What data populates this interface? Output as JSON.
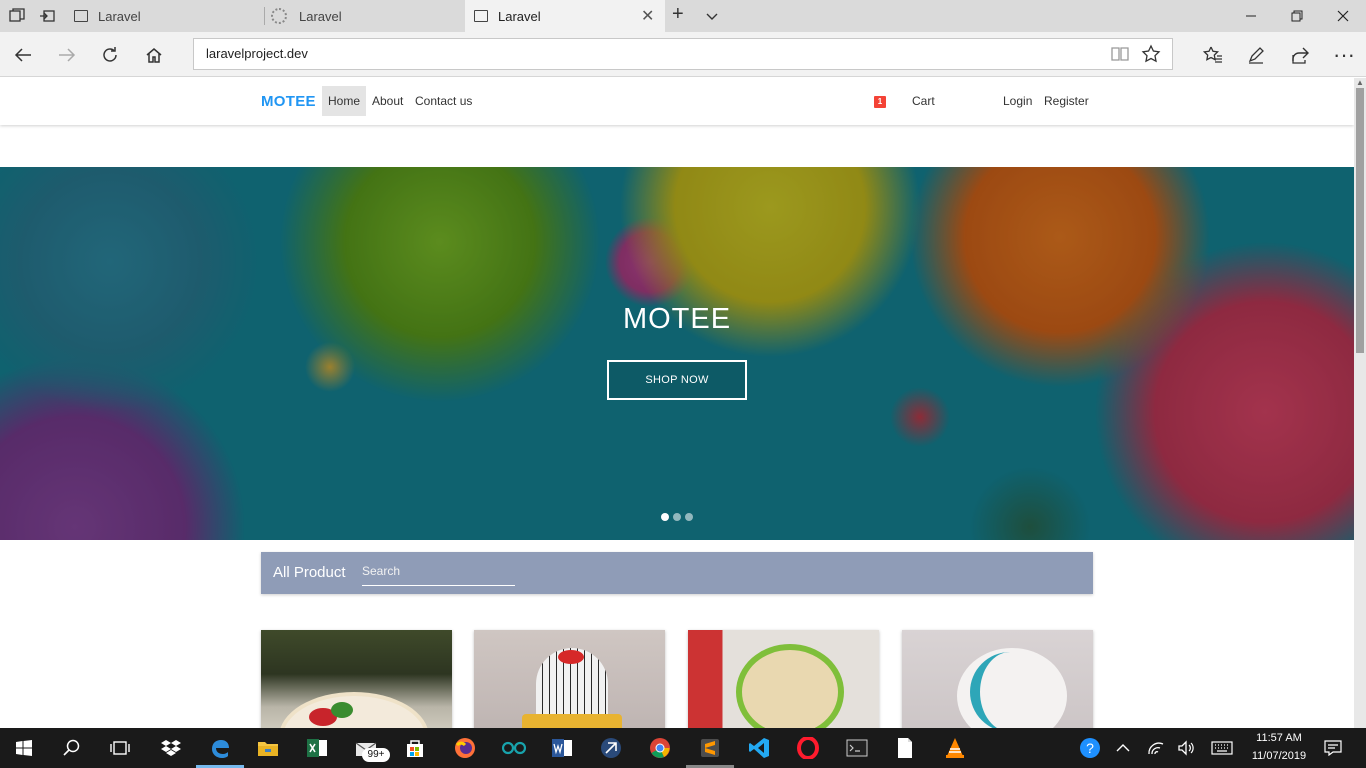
{
  "browser": {
    "tabs": [
      {
        "label": "Laravel"
      },
      {
        "label": "Laravel"
      },
      {
        "label": "Laravel"
      }
    ],
    "url": "laravelproject.dev"
  },
  "site": {
    "brand": "MOTEE",
    "nav": {
      "home": "Home",
      "about": "About",
      "contact": "Contact us",
      "cart_count": "1",
      "cart": "Cart",
      "login": "Login",
      "register": "Register"
    },
    "hero": {
      "title": "MOTEE",
      "button": "SHOP NOW",
      "slides": 3,
      "active_slide": 1
    },
    "products": {
      "title": "All Product",
      "search_placeholder": "Search"
    }
  },
  "taskbar": {
    "mail_badge": "99+",
    "time": "11:57 AM",
    "date": "11/07/2019"
  },
  "colors": {
    "brand": "#2196f3",
    "product_bar": "#8f9cb7",
    "cart_badge": "#f44336",
    "taskbar": "#1a1a1a"
  }
}
